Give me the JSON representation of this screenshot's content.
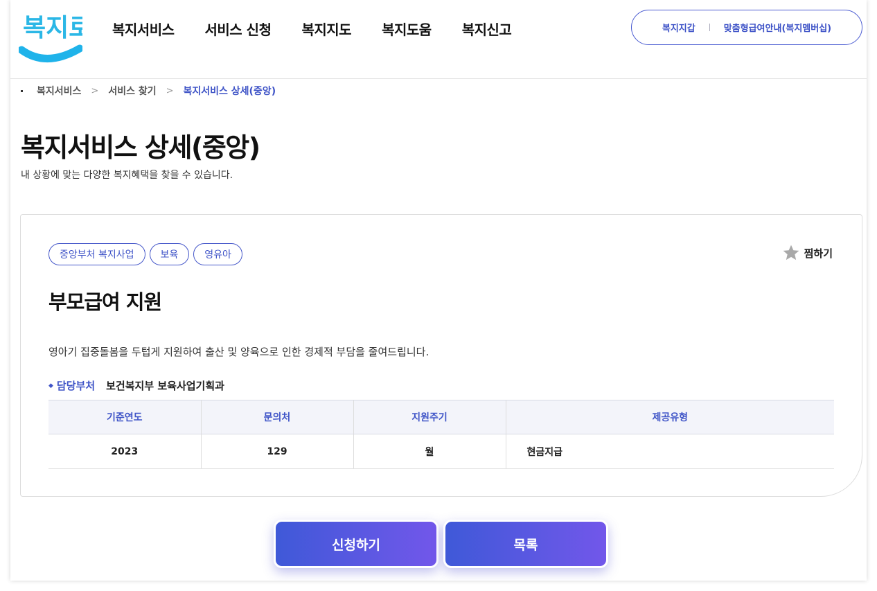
{
  "logo": {
    "text": "복지로"
  },
  "gnb": [
    "복지서비스",
    "서비스 신청",
    "복지지도",
    "복지도움",
    "복지신고"
  ],
  "util": {
    "link1": "복지지갑",
    "link2": "맞춤형급여안내(복지멤버십)"
  },
  "breadcrumb": [
    "복지서비스",
    "서비스 찾기",
    "복지서비스 상세(중앙)"
  ],
  "page": {
    "title": "복지서비스 상세(중앙)",
    "subtitle": "내 상황에 맞는 다양한 복지혜택을 찾을 수 있습니다."
  },
  "service": {
    "tags": [
      "중앙부처 복지사업",
      "보육",
      "영유아"
    ],
    "favorite_label": "찜하기",
    "name": "부모급여 지원",
    "description": "영아기 집중돌봄을 두텁게 지원하여 출산 및 양육으로 인한 경제적 부담을 줄여드립니다.",
    "dept_label": "담당부처",
    "dept_value": "보건복지부 보육사업기획과",
    "table": {
      "headers": [
        "기준연도",
        "문의처",
        "지원주기",
        "제공유형"
      ],
      "row": [
        "2023",
        "129",
        "월",
        "현금지급"
      ]
    }
  },
  "buttons": {
    "apply": "신청하기",
    "list": "목록"
  },
  "colors": {
    "accent": "#3f54c7",
    "button_start": "#3f59d8",
    "button_end": "#7257ea",
    "logo_blue": "#22b8e8"
  }
}
